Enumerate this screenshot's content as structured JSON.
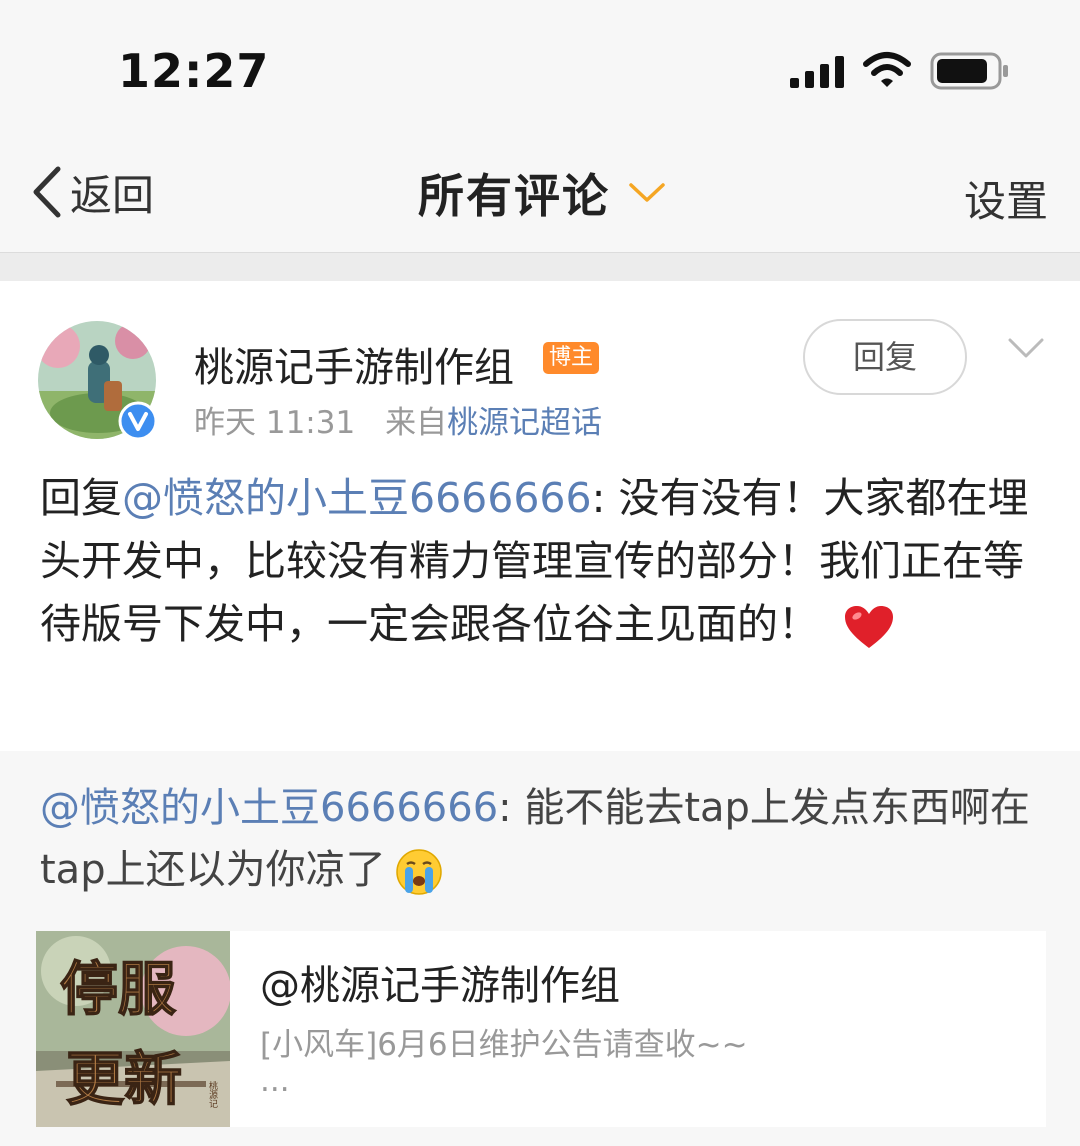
{
  "status_bar": {
    "time": "12:27"
  },
  "nav": {
    "back_label": "返回",
    "title": "所有评论",
    "settings_label": "设置"
  },
  "comment": {
    "author": "桃源记手游制作组",
    "role_badge": "博主",
    "time": "昨天 11:31",
    "source_prefix": "来自",
    "source": "桃源记超话",
    "reply_button": "回复",
    "reply_prefix": "回复",
    "mention": "@愤怒的小土豆6666666",
    "text": ": 没有没有！大家都在埋头开发中，比较没有精力管理宣传的部分！我们正在等待版号下发中，一定会跟各位谷主见面的！"
  },
  "quote": {
    "mention": "@愤怒的小土豆6666666",
    "text": ": 能不能去tap上发点东西啊在tap上还以为你凉了"
  },
  "link_card": {
    "thumb_text": "停服更新",
    "thumb_seal": "桃源记",
    "author": "@桃源记手游制作组",
    "description": "[小风车]6月6日维护公告请查收~~",
    "ellipsis": "..."
  },
  "colors": {
    "link": "#5b7fb5",
    "badge": "#ff8a2b",
    "chevron": "#f5a623",
    "verified": "#3d8ef0"
  }
}
